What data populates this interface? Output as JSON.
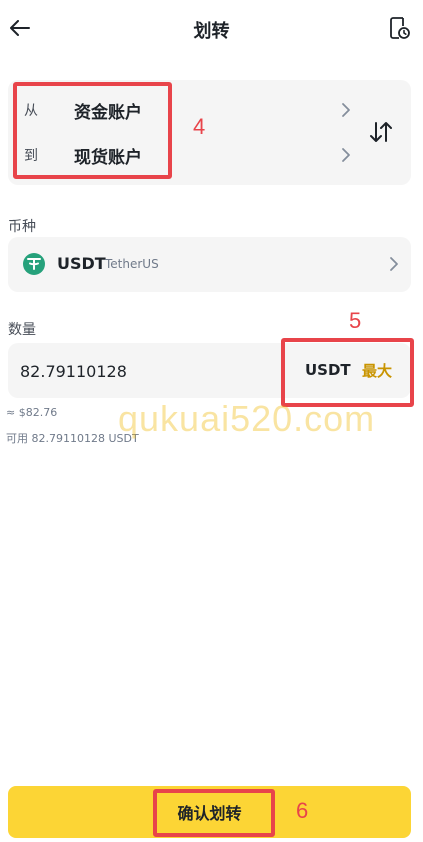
{
  "header": {
    "title": "划转"
  },
  "accounts": {
    "from_prefix": "从",
    "from_name": "资金账户",
    "to_prefix": "到",
    "to_name": "现货账户"
  },
  "coin": {
    "section_label": "币种",
    "symbol": "USDT",
    "full_name": "TetherUS",
    "icon_color": "#26a17b"
  },
  "amount": {
    "section_label": "数量",
    "value": "82.79110128",
    "unit": "USDT",
    "max_label": "最大",
    "fiat_value": "≈ $82.76",
    "available": "可用 82.79110128 USDT"
  },
  "confirm": {
    "label": "确认划转"
  },
  "annotations": {
    "num_4": "4",
    "num_5": "5",
    "num_6": "6",
    "color": "#e8444a"
  },
  "watermark": {
    "text": "qukuai520.com"
  },
  "colors": {
    "accent_yellow": "#fcd535",
    "max_gold": "#c99400",
    "card_bg": "#f5f5f5"
  }
}
